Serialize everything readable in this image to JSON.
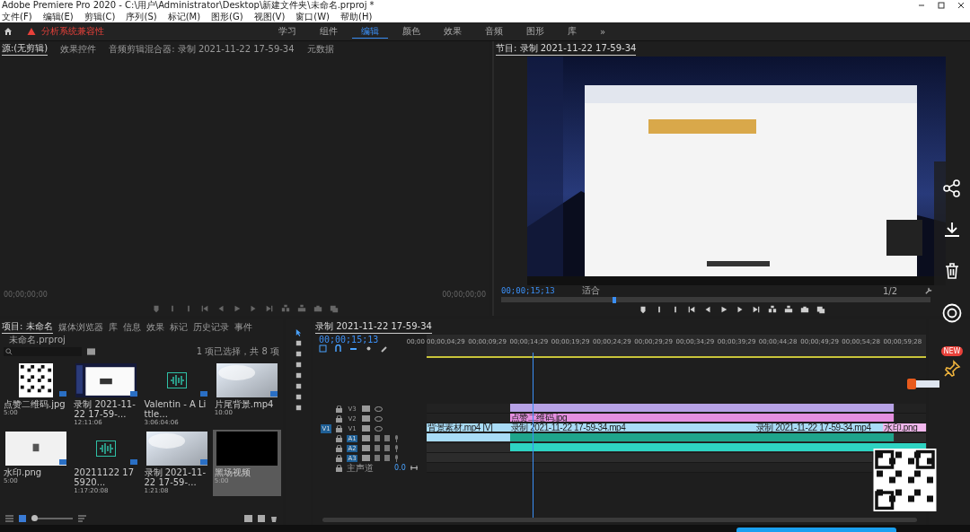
{
  "window": {
    "title": "Adobe Premiere Pro 2020 - C:\\用户\\Administrator\\Desktop\\新建文件夹\\未命名.prproj *"
  },
  "menu": [
    "文件(F)",
    "编辑(E)",
    "剪辑(C)",
    "序列(S)",
    "标记(M)",
    "图形(G)",
    "视图(V)",
    "窗口(W)",
    "帮助(H)"
  ],
  "header": {
    "alert": "分析系统兼容性",
    "workspaces": [
      {
        "label": "学习",
        "selected": false
      },
      {
        "label": "组件",
        "selected": false
      },
      {
        "label": "编辑",
        "selected": true
      },
      {
        "label": "颜色",
        "selected": false
      },
      {
        "label": "效果",
        "selected": false
      },
      {
        "label": "音频",
        "selected": false
      },
      {
        "label": "图形",
        "selected": false
      },
      {
        "label": "库",
        "selected": false
      }
    ],
    "more": "»"
  },
  "source_panel": {
    "tabs": [
      {
        "label": "源:(无剪辑)",
        "selected": true
      },
      {
        "label": "效果控件",
        "selected": false
      },
      {
        "label": "音频剪辑混合器: 录制 2021-11-22 17-59-34",
        "selected": false
      },
      {
        "label": "元数据",
        "selected": false
      }
    ],
    "timecode_in": "00;00;00;00",
    "timecode_out": "00;00;00;00"
  },
  "program_panel": {
    "title": "节目: 录制 2021-11-22 17-59-34",
    "timecode": "00;00;15;13",
    "fit": "适合",
    "resolution": "1/2",
    "scrubber": {
      "level": 0.26
    }
  },
  "project_panel": {
    "tabs": [
      {
        "label": "项目: 未命名",
        "selected": true
      },
      {
        "label": "媒体浏览器",
        "selected": false
      },
      {
        "label": "库",
        "selected": false
      },
      {
        "label": "信息",
        "selected": false
      },
      {
        "label": "效果",
        "selected": false
      },
      {
        "label": "标记",
        "selected": false
      },
      {
        "label": "历史记录",
        "selected": false
      },
      {
        "label": "事件",
        "selected": false
      }
    ],
    "file": "未命名.prproj",
    "zoom": {
      "level": 0.05
    },
    "count": "1 项已选择，共 8 项",
    "items": [
      {
        "name": "点赞二维码.jpg",
        "duration": "5:00",
        "kind": "qr",
        "selected": false
      },
      {
        "name": "录制 2021-11-22 17-59-...",
        "duration": "12:11:06",
        "kind": "screen",
        "selected": false
      },
      {
        "name": "Valentin - A Little...",
        "duration": "3:06:04:06",
        "kind": "audio",
        "selected": false
      },
      {
        "name": "片尾背景.mp4",
        "duration": "10:00",
        "kind": "gradient",
        "selected": false
      },
      {
        "name": "水印.png",
        "duration": "5:00",
        "kind": "white",
        "selected": false
      },
      {
        "name": "20211122 175920...",
        "duration": "1:17:20:08",
        "kind": "audio",
        "selected": false
      },
      {
        "name": "录制 2021-11-22 17-59-...",
        "duration": "1:21:08",
        "kind": "gradient",
        "selected": false
      },
      {
        "name": "黑场视频",
        "duration": "5:00",
        "kind": "black",
        "selected": true
      }
    ]
  },
  "timeline": {
    "title": "录制 2021-11-22 17-59-34",
    "timecode": "00;00;15;13",
    "ruler": {
      "start": "00;00",
      "ticks": [
        "00;00;04;29",
        "00;00;09;29",
        "00;00;14;29",
        "00;00;19;29",
        "00;00;24;29",
        "00;00;29;29",
        "00;00;34;29",
        "00;00;39;29",
        "00;00;44;28",
        "00;00;49;29",
        "00;00;54;28",
        "00;00;59;28"
      ]
    },
    "tracks": [
      {
        "label": "V3",
        "kind": "video",
        "target": false,
        "clips": [
          {
            "color": "#b7a2e6"
          }
        ]
      },
      {
        "label": "V2",
        "kind": "video",
        "target": false,
        "clips": [
          {
            "label": "点赞二维码.jpg",
            "color": "#e58fe0"
          }
        ]
      },
      {
        "label": "V1",
        "kind": "video",
        "target": false,
        "source_patch": "V1",
        "clips": [
          {
            "label": "背景素材.mp4 [V]",
            "color": "#a9dcf7"
          },
          {
            "label": "录制 2021-11-22 17-59-34.mp4",
            "color": "#a9dcf7"
          },
          {
            "color": "#a9dcf7"
          },
          {
            "label": "录制 2021-11-22 17-59-34.mp4",
            "color": "#a9dcf7"
          },
          {
            "label": "水印.png",
            "color": "#f3b8ee"
          }
        ]
      },
      {
        "label": "A1",
        "kind": "audio",
        "target": true,
        "clips": [
          {
            "color": "#a9dcf7"
          },
          {
            "color": "#1fa58c"
          },
          {
            "color": "#1fa58c"
          }
        ]
      },
      {
        "label": "A2",
        "kind": "audio",
        "target": true,
        "clips": [
          {
            "color": "#2ed3c2"
          }
        ]
      },
      {
        "label": "A3",
        "kind": "audio",
        "target": true
      },
      {
        "label": "主声道",
        "kind": "master",
        "target": false,
        "volume": "0.0"
      }
    ]
  },
  "overlay": {
    "badge": "NEW"
  }
}
